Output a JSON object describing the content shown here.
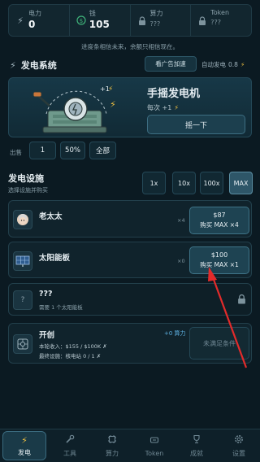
{
  "stats": [
    {
      "label": "电力",
      "value": "0",
      "icon": "lightning-icon"
    },
    {
      "label": "钱",
      "value": "105",
      "icon": "dollar-icon"
    },
    {
      "label": "算力",
      "value": "???",
      "icon": "lock-icon"
    },
    {
      "label": "Token",
      "value": "???",
      "icon": "lock-icon"
    }
  ],
  "notice": "进度条相信未来，余额只相信现在。",
  "power_section": {
    "title": "发电系统",
    "ad_button": "看广告加速",
    "auto_label": "自动发电",
    "auto_value": "0.8"
  },
  "generator": {
    "title": "手摇发电机",
    "rate_label": "每次 +1",
    "crank_button": "摇一下",
    "badge": "+1"
  },
  "sell": {
    "label": "出售",
    "options": [
      "1",
      "50%",
      "全部"
    ]
  },
  "facilities": {
    "title": "发电设施",
    "subtitle": "选择设施并购买",
    "quantities": [
      "1x",
      "10x",
      "100x",
      "MAX"
    ],
    "active_quantity": "MAX"
  },
  "items": [
    {
      "name": "老太太",
      "count": "×4",
      "price": "$87",
      "action": "购买 MAX ×4"
    },
    {
      "name": "太阳能板",
      "count": "×0",
      "price": "$100",
      "action": "购买 MAX ×1"
    }
  ],
  "locked_item": {
    "name": "???",
    "requirement": "需要 1 个太阳能板"
  },
  "startup": {
    "name": "开创",
    "bonus": "+0 算力",
    "line1": "本轮收入：$155 / $100K ✗",
    "line2": "最终设施：核电站 0 / 1 ✗",
    "status": "未满足条件"
  },
  "nav": [
    {
      "label": "发电",
      "icon": "lightning-icon",
      "active": true
    },
    {
      "label": "工具",
      "icon": "wrench-icon",
      "active": false
    },
    {
      "label": "算力",
      "icon": "cpu-icon",
      "active": false
    },
    {
      "label": "Token",
      "icon": "token-icon",
      "active": false
    },
    {
      "label": "成就",
      "icon": "trophy-icon",
      "active": false
    },
    {
      "label": "设置",
      "icon": "gear-icon",
      "active": false
    }
  ],
  "colors": {
    "accent": "#2e5668",
    "highlight_arrow": "#e32b2b",
    "bolt": "#f0c040"
  }
}
